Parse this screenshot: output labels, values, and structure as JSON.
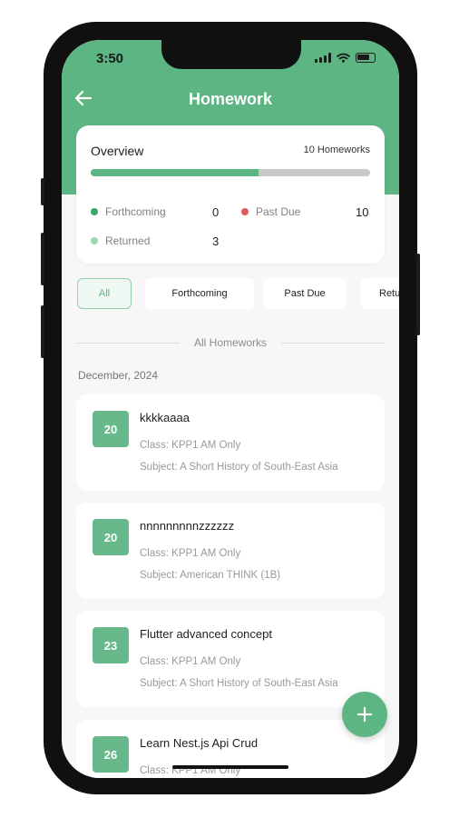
{
  "status_bar": {
    "time": "3:50"
  },
  "header": {
    "title": "Homework",
    "back_icon": "arrow-left-icon"
  },
  "overview": {
    "title": "Overview",
    "count_label": "10 Homeworks",
    "progress_fraction": 0.6,
    "stats": [
      {
        "label": "Forthcoming",
        "value": "0",
        "color": "#3aa56b"
      },
      {
        "label": "Past Due",
        "value": "10",
        "color": "#e05a5a"
      },
      {
        "label": "Returned",
        "value": "3",
        "color": "#9fd6b3"
      }
    ]
  },
  "filters": [
    "All",
    "Forthcoming",
    "Past Due",
    "Retu"
  ],
  "section_label": "All Homeworks",
  "month_label": "December, 2024",
  "homeworks": [
    {
      "day": "20",
      "title": "kkkkaaaa",
      "class": "Class: KPP1 AM Only",
      "subject": "Subject: A Short History of South-East Asia"
    },
    {
      "day": "20",
      "title": "nnnnnnnnnzzzzzz",
      "class": "Class: KPP1 AM Only",
      "subject": "Subject: American THINK (1B)"
    },
    {
      "day": "23",
      "title": "Flutter advanced concept",
      "class": "Class: KPP1 AM Only",
      "subject": "Subject: A Short History of South-East Asia"
    },
    {
      "day": "26",
      "title": "Learn Nest.js Api Crud",
      "class": "Class: KPP1 AM Only",
      "subject": ""
    }
  ],
  "fab_icon": "plus-icon",
  "colors": {
    "primary": "#5cb583",
    "background": "#f7f7f7"
  }
}
